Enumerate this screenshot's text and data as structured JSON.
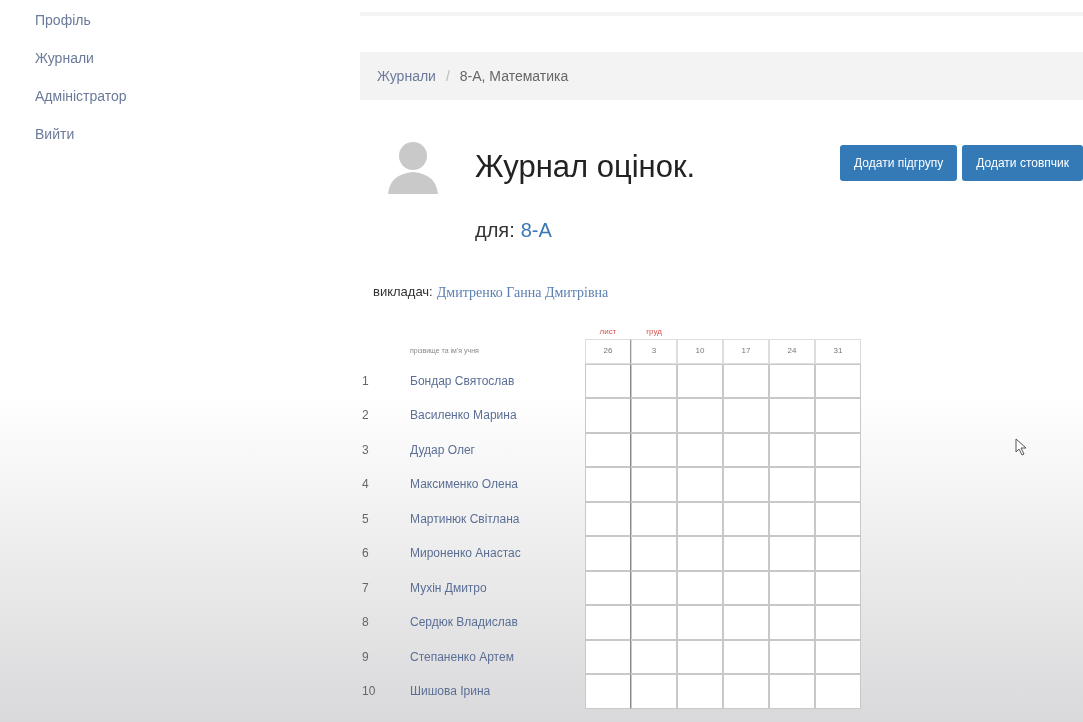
{
  "sidebar": {
    "items": [
      {
        "label": "Профіль"
      },
      {
        "label": "Журнали"
      },
      {
        "label": "Адміністратор"
      },
      {
        "label": "Вийти"
      }
    ]
  },
  "breadcrumb": [
    "Журнали",
    "8-А, Математика"
  ],
  "breadcrumb_separator": "/",
  "title": "Журнал оцінок.",
  "class_prefix": "для:",
  "class_name": "8-А",
  "buttons": [
    "Додати підгрупу",
    "Додати стовпчик"
  ],
  "teacher_label": "викладач:",
  "teacher_name": "Дмитренко Ганна Дмитрівна",
  "months": [
    "лист",
    "груд"
  ],
  "table": {
    "name_header": "прізвище та ім'я учня",
    "dates": [
      "26",
      "3",
      "10",
      "17",
      "24",
      "31"
    ],
    "rows": [
      {
        "number": "1",
        "name": "Бондар Святослав"
      },
      {
        "number": "2",
        "name": "Василенко Марина"
      },
      {
        "number": "3",
        "name": "Дудар Олег"
      },
      {
        "number": "4",
        "name": "Максименко Олена"
      },
      {
        "number": "5",
        "name": "Мартинюк Світлана"
      },
      {
        "number": "6",
        "name": "Мироненко Анастас"
      },
      {
        "number": "7",
        "name": "Мухін Дмитро"
      },
      {
        "number": "8",
        "name": "Сердюк Владислав"
      },
      {
        "number": "9",
        "name": "Степаненко Артем"
      },
      {
        "number": "10",
        "name": "Шишова Ірина"
      }
    ]
  }
}
